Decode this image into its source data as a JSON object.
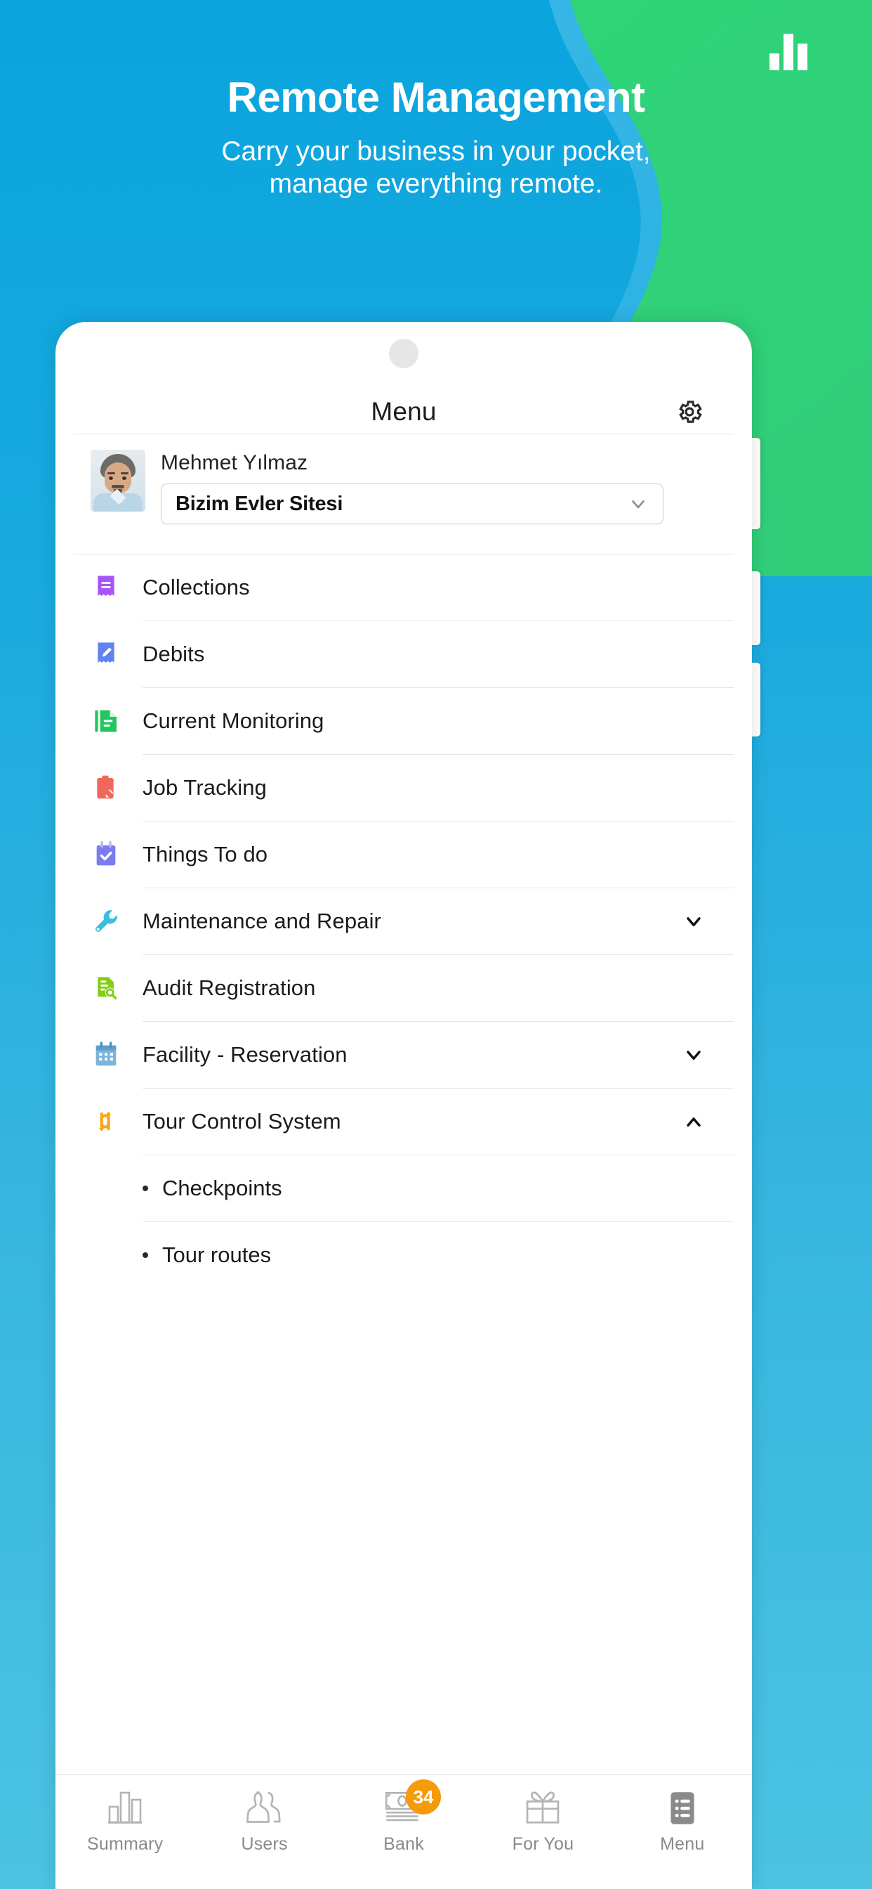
{
  "hero": {
    "title": "Remote Management",
    "subtitle_line1": "Carry your business in your pocket,",
    "subtitle_line2": "manage everything remote.",
    "logo_icon": "bar-chart-logo"
  },
  "colors": {
    "background_top": "#0BA4DE",
    "background_bottom": "#4CC3E2",
    "green_blob": "#2ECC71",
    "badge_orange": "#F59A0B",
    "accent_purple": "#A855F7",
    "accent_blue": "#6183F0",
    "accent_green": "#22C55E",
    "accent_red": "#F0685B",
    "accent_indigo": "#7C7CF0",
    "accent_cyan": "#3ABEDC",
    "accent_lime": "#84CC16",
    "accent_sky": "#7FB3DA",
    "accent_orange": "#FAA61A"
  },
  "phone": {
    "header": {
      "title": "Menu",
      "settings_icon": "gear-icon"
    },
    "profile": {
      "name": "Mehmet Yılmaz",
      "site_selected": "Bizim Evler Sitesi",
      "site_dropdown_icon": "chevron-down-icon",
      "avatar_icon": "user-photo"
    },
    "menu_items": [
      {
        "label": "Collections",
        "icon": "receipt-icon",
        "expandable": false,
        "expanded": false
      },
      {
        "label": "Debits",
        "icon": "receipt-pencil-icon",
        "expandable": false,
        "expanded": false
      },
      {
        "label": "Current Monitoring",
        "icon": "document-icon",
        "expandable": false,
        "expanded": false
      },
      {
        "label": "Job Tracking",
        "icon": "clipboard-pencil-icon",
        "expandable": false,
        "expanded": false
      },
      {
        "label": "Things To do",
        "icon": "calendar-check-icon",
        "expandable": false,
        "expanded": false
      },
      {
        "label": "Maintenance and Repair",
        "icon": "wrench-icon",
        "expandable": true,
        "expanded": false
      },
      {
        "label": "Audit Registration",
        "icon": "document-search-icon",
        "expandable": false,
        "expanded": false
      },
      {
        "label": "Facility - Reservation",
        "icon": "calendar-grid-icon",
        "expandable": true,
        "expanded": false
      },
      {
        "label": "Tour Control System",
        "icon": "route-arrows-icon",
        "expandable": true,
        "expanded": true
      }
    ],
    "submenu_items": [
      {
        "label": "Checkpoints"
      },
      {
        "label": "Tour routes"
      }
    ],
    "bottom_nav": [
      {
        "label": "Summary",
        "icon": "bar-chart-icon",
        "badge": null,
        "active": false
      },
      {
        "label": "Users",
        "icon": "users-icon",
        "badge": null,
        "active": false
      },
      {
        "label": "Bank",
        "icon": "banknote-icon",
        "badge": "34",
        "active": false
      },
      {
        "label": "For You",
        "icon": "gift-icon",
        "badge": null,
        "active": false
      },
      {
        "label": "Menu",
        "icon": "list-menu-icon",
        "badge": null,
        "active": true
      }
    ]
  }
}
